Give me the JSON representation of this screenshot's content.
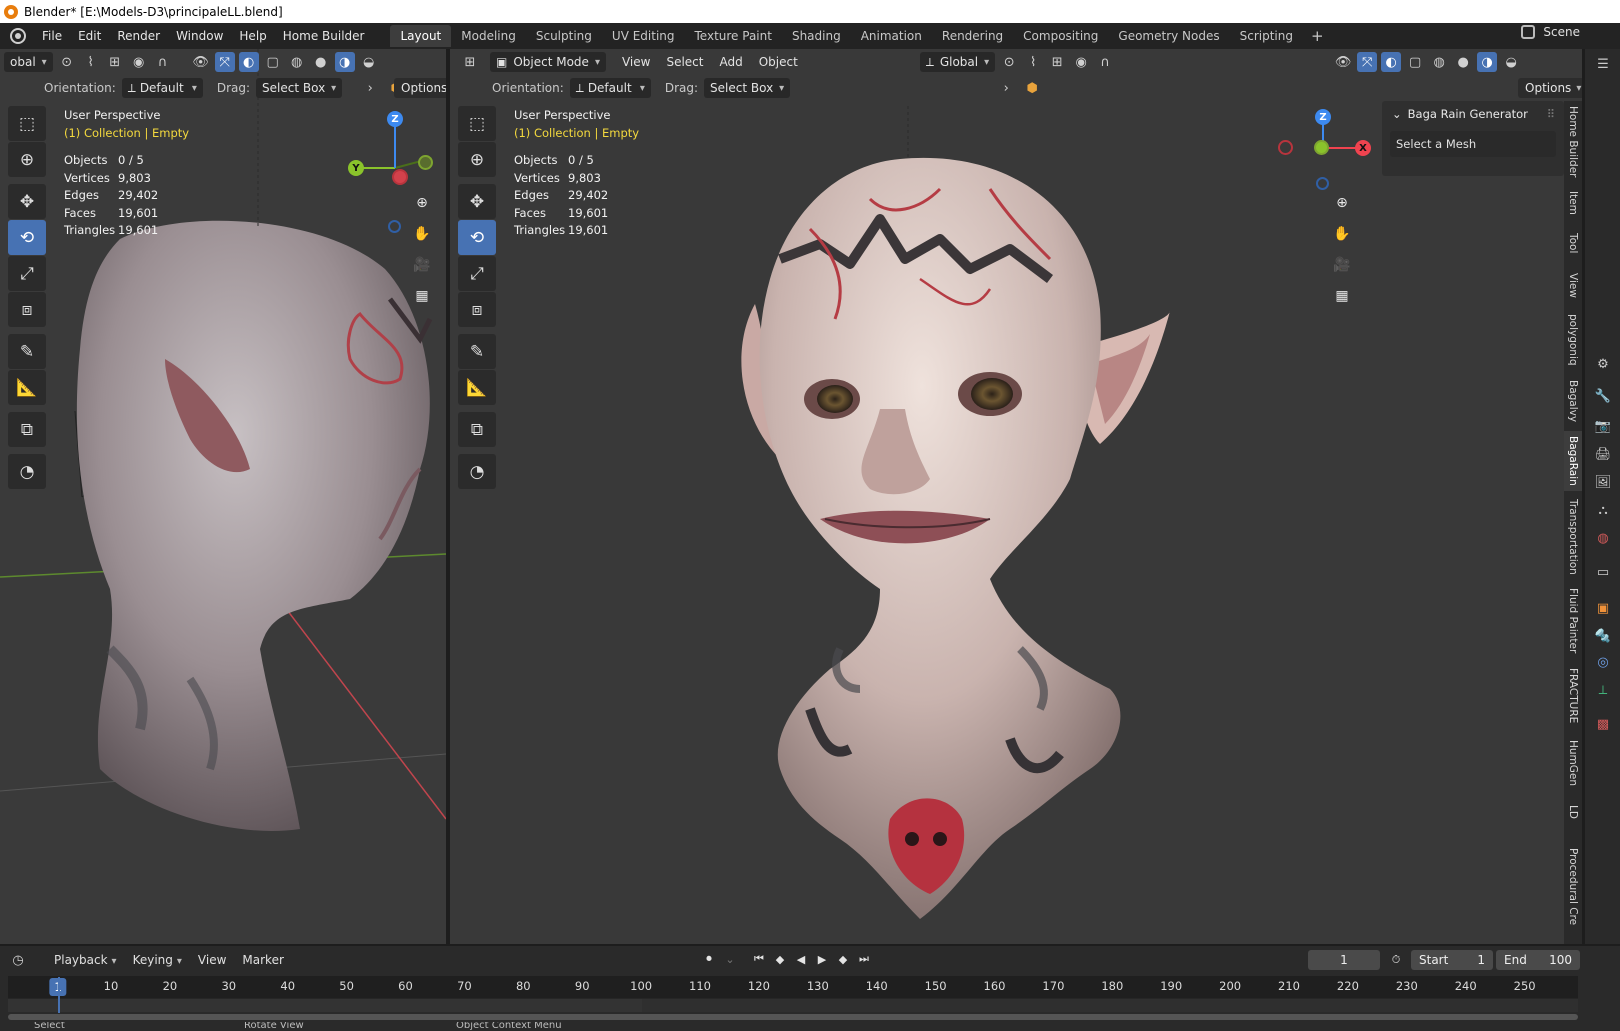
{
  "window": {
    "title": "Blender* [E:\\Models-D3\\principaleLL.blend]"
  },
  "menu": [
    "File",
    "Edit",
    "Render",
    "Window",
    "Help",
    "Home Builder"
  ],
  "workspaces": [
    "Layout",
    "Modeling",
    "Sculpting",
    "UV Editing",
    "Texture Paint",
    "Shading",
    "Animation",
    "Rendering",
    "Compositing",
    "Geometry Nodes",
    "Scripting"
  ],
  "active_workspace": "Layout",
  "scene": "Scene",
  "left_view": {
    "transform": "obal",
    "orientation_label": "Orientation:",
    "orientation_value": "Default",
    "drag_label": "Drag:",
    "drag_value": "Select Box",
    "options": "Options",
    "perspective": "User Perspective",
    "collection": "(1) Collection | Empty",
    "stats": [
      {
        "label": "Objects",
        "value": "0 / 5"
      },
      {
        "label": "Vertices",
        "value": "9,803"
      },
      {
        "label": "Edges",
        "value": "29,402"
      },
      {
        "label": "Faces",
        "value": "19,601"
      },
      {
        "label": "Triangles",
        "value": "19,601"
      }
    ],
    "gizmo": {
      "y": "Y",
      "z": "Z"
    }
  },
  "right_view": {
    "mode": "Object Mode",
    "menu": [
      "View",
      "Select",
      "Add",
      "Object"
    ],
    "transform": "Global",
    "orientation_label": "Orientation:",
    "orientation_value": "Default",
    "drag_label": "Drag:",
    "drag_value": "Select Box",
    "options": "Options",
    "perspective": "User Perspective",
    "collection": "(1) Collection | Empty",
    "stats": [
      {
        "label": "Objects",
        "value": "0 / 5"
      },
      {
        "label": "Vertices",
        "value": "9,803"
      },
      {
        "label": "Edges",
        "value": "29,402"
      },
      {
        "label": "Faces",
        "value": "19,601"
      },
      {
        "label": "Triangles",
        "value": "19,601"
      }
    ],
    "gizmo": {
      "x": "X",
      "z": "Z"
    },
    "panel": {
      "title": "Baga Rain Generator",
      "field": "Select a Mesh"
    },
    "tabs": [
      "Home Builder",
      "Item",
      "Tool",
      "View",
      "polygoniq",
      "Bagalvy",
      "BagaRain",
      "Transportation",
      "Fluid Painter",
      "FRACTURE",
      "HumGen",
      "LD",
      "Procedural Cre"
    ],
    "active_tab": "BagaRain"
  },
  "timeline": {
    "menu": [
      "Playback",
      "Keying",
      "View",
      "Marker"
    ],
    "current_frame": "1",
    "start_label": "Start",
    "start": "1",
    "end_label": "End",
    "end": "100",
    "ticks": [
      "10",
      "20",
      "30",
      "40",
      "50",
      "60",
      "70",
      "80",
      "90",
      "100",
      "110",
      "120",
      "130",
      "140",
      "150",
      "160",
      "170",
      "180",
      "190",
      "200",
      "210",
      "220",
      "230",
      "240",
      "250"
    ],
    "cursor": "1"
  },
  "status": [
    "Select",
    "Rotate View",
    "Object Context Menu"
  ],
  "colors": {
    "accent": "#4772b3",
    "collection": "#f4d93e",
    "x_axis": "#f0434f",
    "y_axis": "#8ac32b",
    "z_axis": "#3d8af0"
  }
}
